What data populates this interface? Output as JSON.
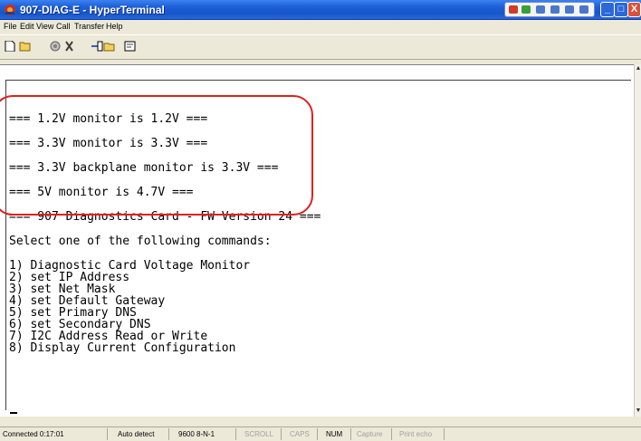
{
  "window": {
    "title": "907-DIAG-E - HyperTerminal",
    "min_glyph": "_",
    "max_glyph": "□",
    "close_glyph": "X"
  },
  "menu": [
    "File",
    "Edit",
    "View",
    "Call",
    "Transfer",
    "Help"
  ],
  "toolbar": {
    "icons": [
      "new-icon",
      "open-icon",
      "call-icon",
      "disconnect-icon",
      "send-icon",
      "receive-icon",
      "properties-icon"
    ]
  },
  "terminal": {
    "lines": [
      "=== 1.2V monitor is 1.2V ===",
      "=== 3.3V monitor is 3.3V ===",
      "=== 3.3V backplane monitor is 3.3V ===",
      "=== 5V monitor is 4.7V ===",
      "=== 907 Diagnostics Card - FW Version 24 ===",
      "Select one of the following commands:",
      "1) Diagnostic Card Voltage Monitor",
      "2) set IP Address",
      "3) set Net Mask",
      "4) set Default Gateway",
      "5) set Primary DNS",
      "6) set Secondary DNS",
      "7) I2C Address Read or Write",
      "8) Display Current Configuration"
    ]
  },
  "status": {
    "connected": "Connected 0:17:01",
    "detect": "Auto detect",
    "settings": "9600 8-N-1",
    "scroll": "SCROLL",
    "caps": "CAPS",
    "num": "NUM",
    "capture": "Capture",
    "print_echo": "Print echo"
  },
  "colors": {
    "highlight": "#e02020",
    "titlebar": "#1f5fd8"
  }
}
